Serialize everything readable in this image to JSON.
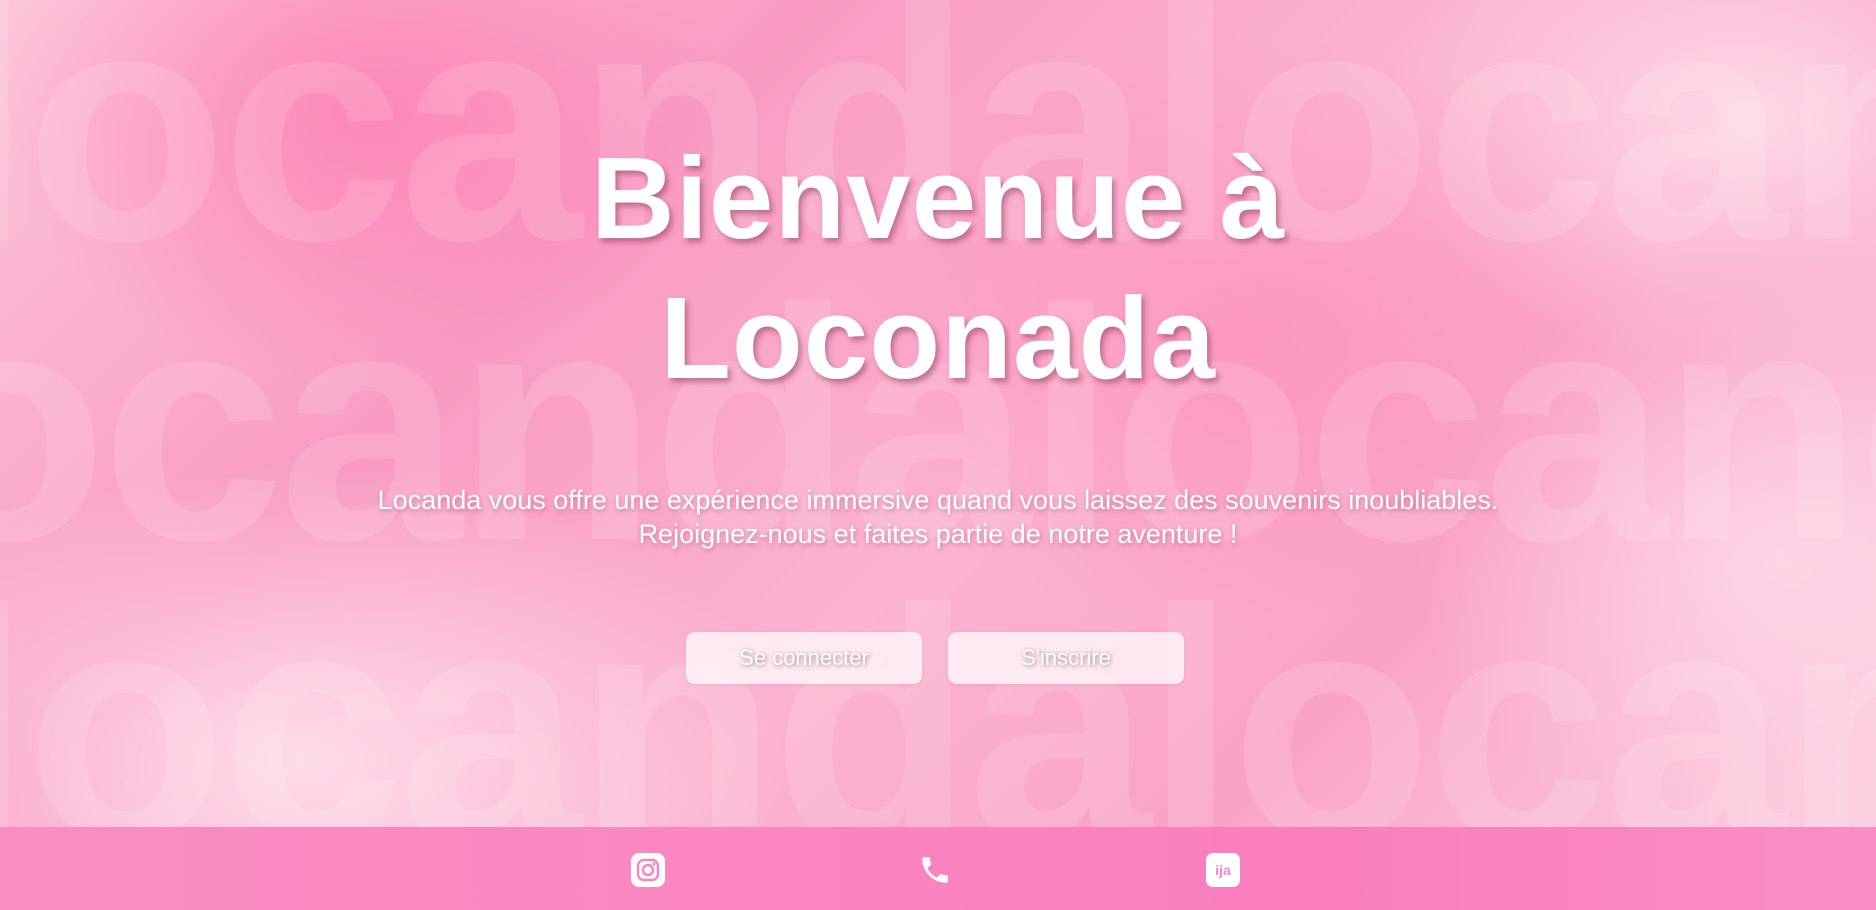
{
  "hero": {
    "title_line1": "Bienvenue à",
    "title_line2": "Loconada",
    "subtitle_line1": "Locanda vous offre une expérience immersive quand vous laissez des souvenirs inoubliables.",
    "subtitle_line2": "Rejoignez-nous et faites partie de notre aventure !",
    "background_watermark": "locanda"
  },
  "buttons": {
    "login_label": "Se connecter",
    "signup_label": "S'inscrire"
  },
  "footer": {
    "icons": [
      {
        "name": "instagram-icon"
      },
      {
        "name": "phone-icon"
      },
      {
        "name": "app-icon",
        "glyph": "ija"
      }
    ]
  },
  "colors": {
    "hero_pink": "#f99bc2",
    "footer_pink": "#fa7dbd",
    "button_background": "#ffffffb8",
    "text": "#ffffff"
  }
}
